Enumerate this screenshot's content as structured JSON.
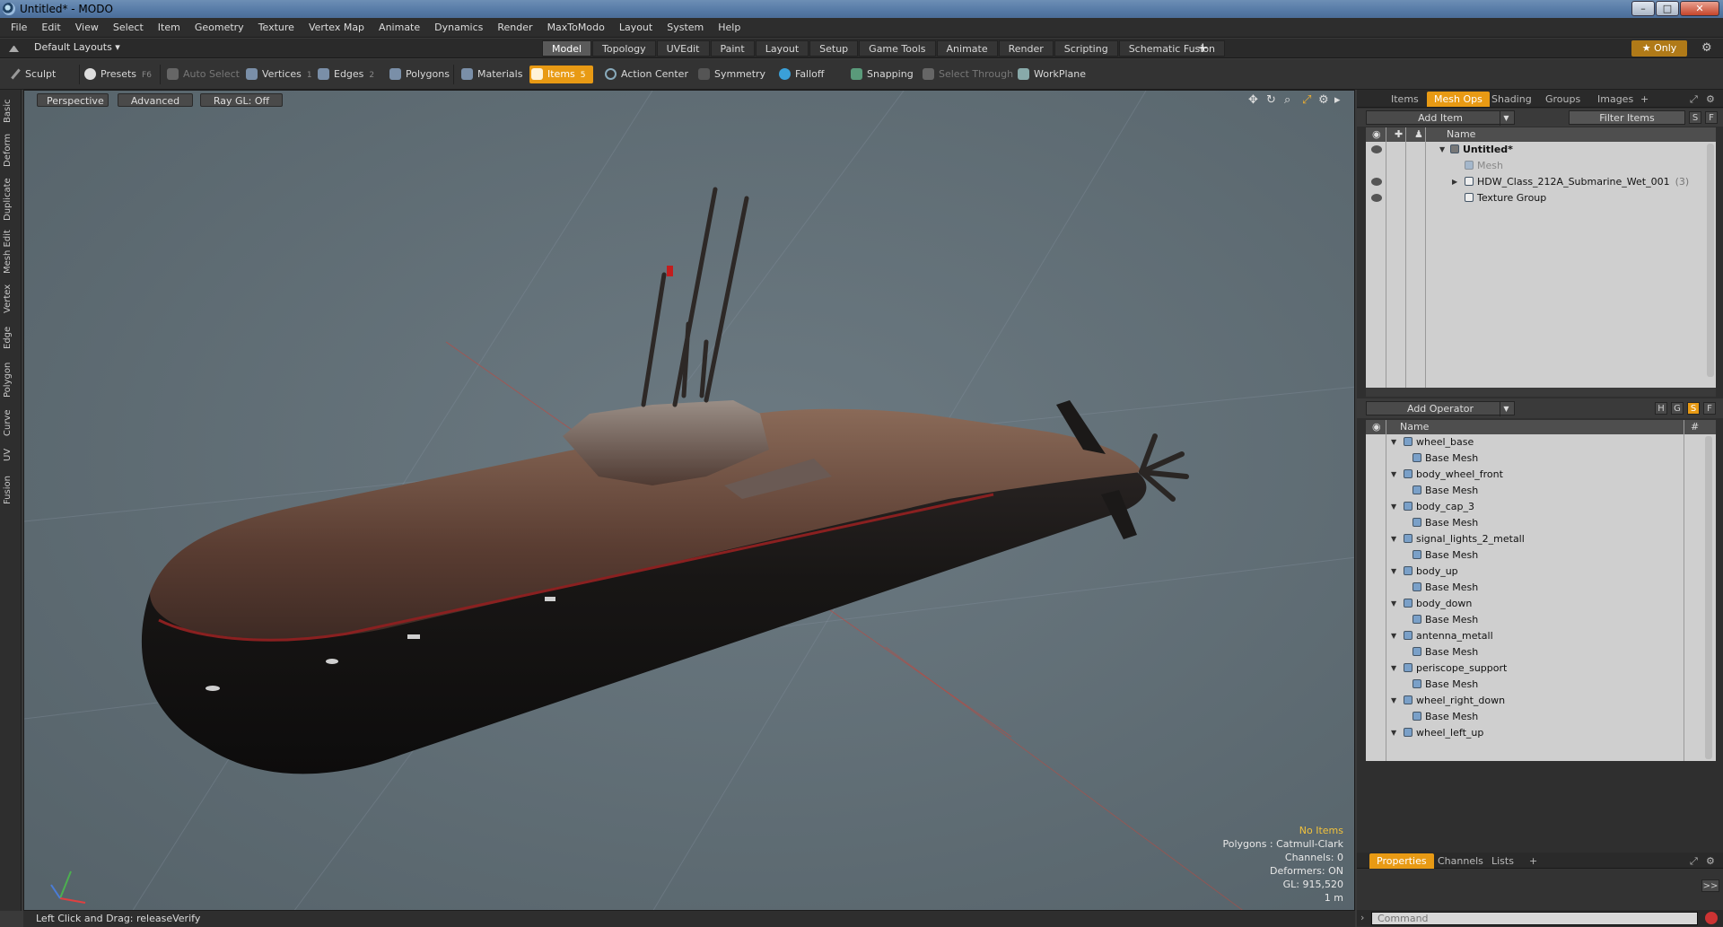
{
  "window": {
    "title": "Untitled* - MODO",
    "min": "–",
    "max": "□",
    "close": "✕"
  },
  "menu": [
    "File",
    "Edit",
    "View",
    "Select",
    "Item",
    "Geometry",
    "Texture",
    "Vertex Map",
    "Animate",
    "Dynamics",
    "Render",
    "MaxToModo",
    "Layout",
    "System",
    "Help"
  ],
  "layout_tabs": {
    "default_layouts": "Default Layouts ▾",
    "tabs": [
      "Model",
      "Topology",
      "UVEdit",
      "Paint",
      "Layout",
      "Setup",
      "Game Tools",
      "Animate",
      "Render",
      "Scripting",
      "Schematic Fusion"
    ],
    "active": "Model",
    "add": "+",
    "only": "★  Only"
  },
  "toolbar": {
    "sculpt": "Sculpt",
    "presets": "Presets",
    "presets_key": "F6",
    "auto_select": "Auto Select",
    "vertices": "Vertices",
    "vertices_key": "1",
    "edges": "Edges",
    "edges_key": "2",
    "polygons": "Polygons",
    "materials": "Materials",
    "items": "Items",
    "items_key": "5",
    "action_center": "Action Center",
    "symmetry": "Symmetry",
    "falloff": "Falloff",
    "snapping": "Snapping",
    "select_through": "Select Through",
    "workplane": "WorkPlane"
  },
  "left_tabs": [
    "Basic",
    "Deform",
    "Duplicate",
    "Mesh Edit",
    "Vertex",
    "Edge",
    "Polygon",
    "Curve",
    "UV",
    "Fusion"
  ],
  "viewport": {
    "perspective": "Perspective",
    "advanced": "Advanced",
    "raygl": "Ray GL: Off",
    "info": {
      "no_items": "No Items",
      "polygons": "Polygons : Catmull-Clark",
      "channels": "Channels: 0",
      "deformers": "Deformers: ON",
      "gl": "GL: 915,520",
      "scale": "1 m"
    }
  },
  "status": {
    "text": "Left Click and Drag:   releaseVerify"
  },
  "items_panel": {
    "tabs": [
      "Items",
      "Mesh Ops",
      "Shading",
      "Groups",
      "Images",
      "+"
    ],
    "active": "Mesh Ops",
    "add_item": "Add Item",
    "filter": "Filter Items",
    "s": "S",
    "f": "F",
    "col_name": "Name",
    "rows": [
      {
        "label": "Untitled*",
        "indent": 0,
        "tri": "▼",
        "bold": true
      },
      {
        "label": "Mesh",
        "indent": 1,
        "tri": "",
        "dim": true
      },
      {
        "label": "HDW_Class_212A_Submarine_Wet_001",
        "indent": 1,
        "tri": "▶",
        "count": "(3)"
      },
      {
        "label": "Texture Group",
        "indent": 1,
        "tri": ""
      }
    ]
  },
  "operators_panel": {
    "add_operator": "Add Operator",
    "h": "H",
    "g": "G",
    "s": "S",
    "f": "F",
    "col_name": "Name",
    "col_hash": "#",
    "rows": [
      {
        "label": "wheel_base",
        "indent": 0
      },
      {
        "label": "Base Mesh",
        "indent": 1
      },
      {
        "label": "body_wheel_front",
        "indent": 0
      },
      {
        "label": "Base Mesh",
        "indent": 1
      },
      {
        "label": "body_cap_3",
        "indent": 0
      },
      {
        "label": "Base Mesh",
        "indent": 1
      },
      {
        "label": "signal_lights_2_metall",
        "indent": 0
      },
      {
        "label": "Base Mesh",
        "indent": 1
      },
      {
        "label": "body_up",
        "indent": 0
      },
      {
        "label": "Base Mesh",
        "indent": 1
      },
      {
        "label": "body_down",
        "indent": 0
      },
      {
        "label": "Base Mesh",
        "indent": 1
      },
      {
        "label": "antenna_metall",
        "indent": 0
      },
      {
        "label": "Base Mesh",
        "indent": 1
      },
      {
        "label": "periscope_support",
        "indent": 0
      },
      {
        "label": "Base Mesh",
        "indent": 1
      },
      {
        "label": "wheel_right_down",
        "indent": 0
      },
      {
        "label": "Base Mesh",
        "indent": 1
      },
      {
        "label": "wheel_left_up",
        "indent": 0
      }
    ]
  },
  "properties_panel": {
    "tabs": [
      "Properties",
      "Channels",
      "Lists",
      "+"
    ],
    "active": "Properties",
    "expand": ">>",
    "command_placeholder": "Command"
  }
}
